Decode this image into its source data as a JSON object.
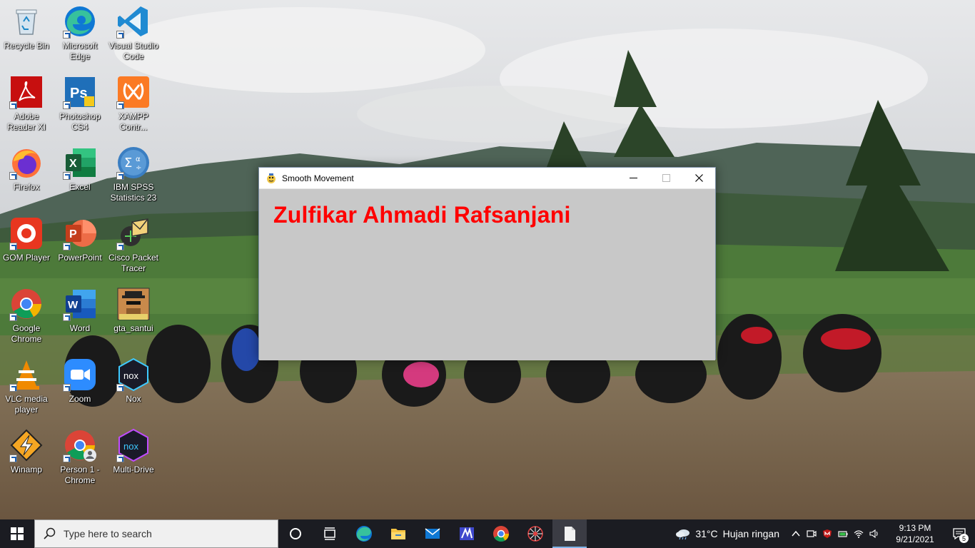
{
  "desktop": {
    "icons": [
      {
        "id": "recycle-bin",
        "label": "Recycle Bin",
        "icon": "recycle-bin-icon"
      },
      {
        "id": "edge",
        "label": "Microsoft Edge",
        "icon": "edge-icon"
      },
      {
        "id": "vscode",
        "label": "Visual Studio Code",
        "icon": "vscode-icon"
      },
      {
        "id": "adobe",
        "label": "Adobe Reader XI",
        "icon": "adobe-reader-icon"
      },
      {
        "id": "photoshop",
        "label": "Photoshop CS4",
        "icon": "photoshop-icon"
      },
      {
        "id": "xampp",
        "label": "XAMPP Contr...",
        "icon": "xampp-icon"
      },
      {
        "id": "firefox",
        "label": "Firefox",
        "icon": "firefox-icon"
      },
      {
        "id": "excel",
        "label": "Excel",
        "icon": "excel-icon"
      },
      {
        "id": "spss",
        "label": "IBM SPSS Statistics 23",
        "icon": "spss-icon"
      },
      {
        "id": "gom",
        "label": "GOM Player",
        "icon": "gom-player-icon"
      },
      {
        "id": "powerpoint",
        "label": "PowerPoint",
        "icon": "powerpoint-icon"
      },
      {
        "id": "cisco",
        "label": "Cisco Packet Tracer",
        "icon": "cisco-packet-tracer-icon"
      },
      {
        "id": "chrome",
        "label": "Google Chrome",
        "icon": "chrome-icon"
      },
      {
        "id": "word",
        "label": "Word",
        "icon": "word-icon"
      },
      {
        "id": "gta",
        "label": "gta_santui",
        "icon": "gta-icon"
      },
      {
        "id": "vlc",
        "label": "VLC media player",
        "icon": "vlc-icon"
      },
      {
        "id": "zoom",
        "label": "Zoom",
        "icon": "zoom-icon"
      },
      {
        "id": "nox",
        "label": "Nox",
        "icon": "nox-icon"
      },
      {
        "id": "winamp",
        "label": "Winamp",
        "icon": "winamp-icon"
      },
      {
        "id": "person-chrome",
        "label": "Person 1 - Chrome",
        "icon": "chrome-profile-icon"
      },
      {
        "id": "multi-drive",
        "label": "Multi-Drive",
        "icon": "nox-multi-drive-icon"
      }
    ]
  },
  "window": {
    "title": "Smooth Movement",
    "canvas_text": "Zulfikar Ahmadi Rafsanjani",
    "canvas_bg": "#c8c8c8",
    "text_color": "#ff0000"
  },
  "taskbar": {
    "search_placeholder": "Type here to search",
    "pinned": [
      "cortana-icon",
      "task-view-icon",
      "edge-icon",
      "file-explorer-icon",
      "mail-icon",
      "app-icon",
      "chrome-icon",
      "spider-icon",
      "document-icon"
    ],
    "weather": {
      "temp": "31°C",
      "condition": "Hujan ringan"
    },
    "clock": {
      "time": "9:13 PM",
      "date": "9/21/2021"
    },
    "notifications": "5"
  }
}
